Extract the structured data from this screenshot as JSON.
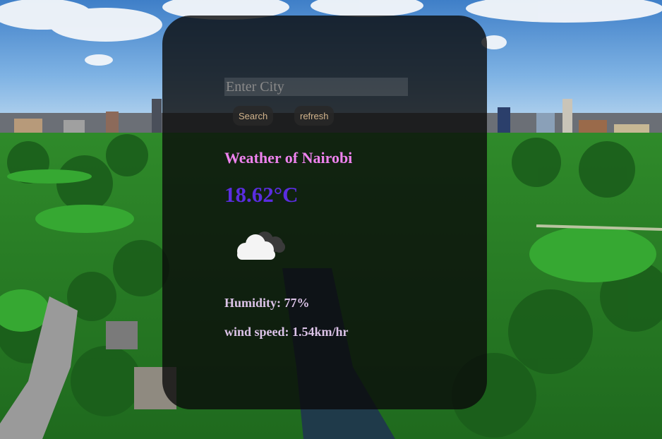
{
  "search": {
    "placeholder": "Enter City",
    "value": ""
  },
  "buttons": {
    "search_label": "Search",
    "refresh_label": "refresh"
  },
  "weather": {
    "title": "Weather of Nairobi",
    "temperature": "18.62°C",
    "icon": "cloud-icon",
    "humidity": "Humidity: 77%",
    "wind_speed": "wind speed: 1.54km/hr"
  },
  "colors": {
    "title": "#ee82ee",
    "temperature": "#5a2de0",
    "details": "#dcc3e8",
    "button_text": "#d2b48c",
    "card_background": "rgba(10,10,10,0.80)"
  }
}
